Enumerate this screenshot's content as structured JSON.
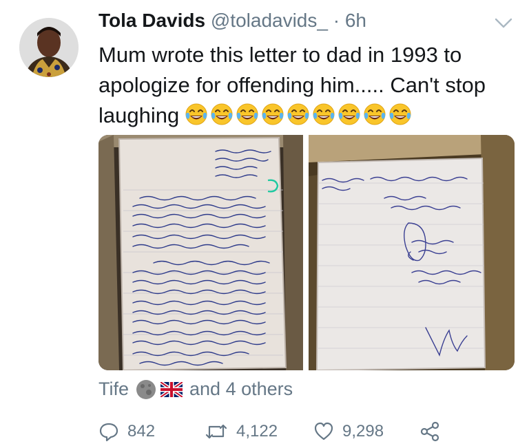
{
  "tweet": {
    "display_name": "Tola Davids",
    "handle": "@toladavids_",
    "separator": "·",
    "time": "6h",
    "text": "Mum wrote this letter to dad in 1993 to apologize for offending him..... Can't stop laughing",
    "emoji_count": 9,
    "emoji": "face-with-tears-of-joy"
  },
  "media": {
    "left_image": "handwritten-letter-page-1",
    "right_image": "handwritten-letter-page-2"
  },
  "likers": {
    "name": "Tife",
    "icons": [
      "moon-ball-icon",
      "uk-flag-icon"
    ],
    "others": "and 4 others"
  },
  "actions": {
    "replies": "842",
    "retweets": "4,122",
    "likes": "9,298"
  },
  "colors": {
    "text": "#14171a",
    "muted": "#657786"
  }
}
